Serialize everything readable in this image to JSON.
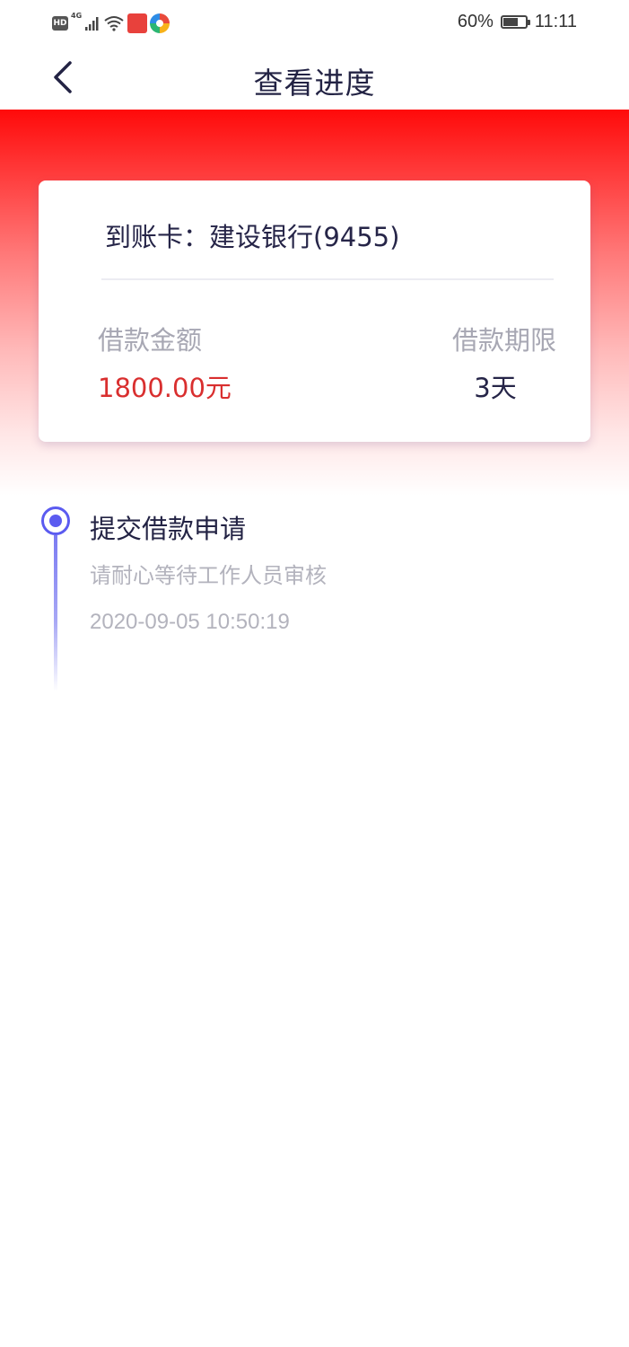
{
  "status_bar": {
    "hd_label": "HD",
    "network_label": "4G",
    "battery_percent": "60%",
    "battery_level": 0.6,
    "time": "11:11"
  },
  "nav": {
    "title": "查看进度"
  },
  "card": {
    "account_label": "到账卡：",
    "account_value": "建设银行(9455)",
    "amount_label": "借款金额",
    "amount_value": "1800.00元",
    "term_label": "借款期限",
    "term_value": "3天"
  },
  "timeline": {
    "steps": [
      {
        "title": "提交借款申请",
        "description": "请耐心等待工作人员审核",
        "time": "2020-09-05 10:50:19"
      }
    ]
  },
  "colors": {
    "brand_red": "#ff0a0a",
    "amount_red": "#d92f2f",
    "timeline_accent": "#5b5bf0",
    "title_text": "#232344",
    "muted_text": "#a7a7b3"
  }
}
